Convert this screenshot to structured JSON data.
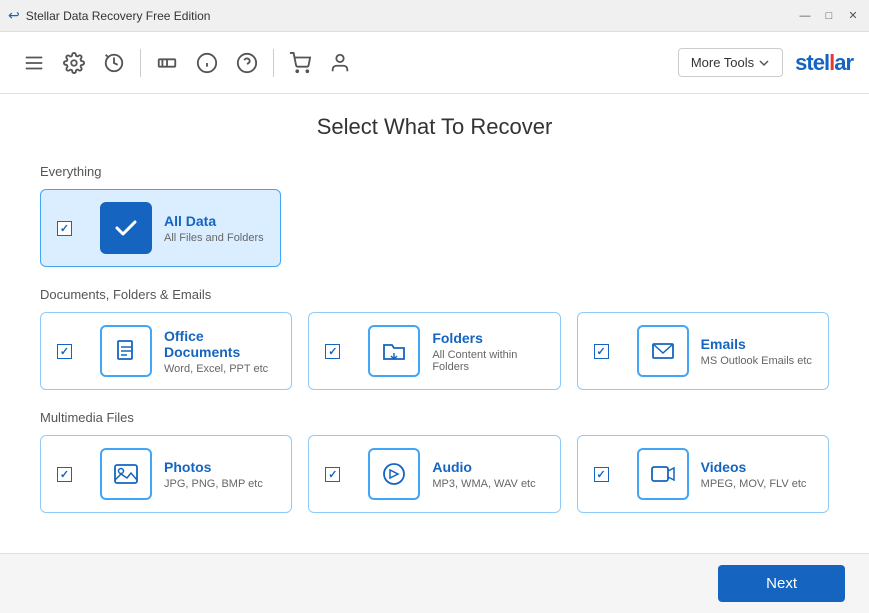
{
  "titleBar": {
    "title": "Stellar Data Recovery Free Edition",
    "minimize": "—",
    "maximize": "□",
    "close": "✕"
  },
  "toolbar": {
    "moreToolsLabel": "More Tools",
    "logoText": "stel",
    "logoAccent": "l",
    "logoRest": "ar"
  },
  "page": {
    "title": "Select What To Recover"
  },
  "sections": [
    {
      "label": "Everything",
      "cards": [
        {
          "id": "all-data",
          "title": "All Data",
          "subtitle": "All Files and Folders",
          "checked": true,
          "selected": true,
          "iconType": "checkmark"
        }
      ]
    },
    {
      "label": "Documents, Folders & Emails",
      "cards": [
        {
          "id": "office-docs",
          "title": "Office Documents",
          "subtitle": "Word, Excel, PPT etc",
          "checked": true,
          "selected": false,
          "iconType": "document"
        },
        {
          "id": "folders",
          "title": "Folders",
          "subtitle": "All Content within Folders",
          "checked": true,
          "selected": false,
          "iconType": "folder"
        },
        {
          "id": "emails",
          "title": "Emails",
          "subtitle": "MS Outlook Emails etc",
          "checked": true,
          "selected": false,
          "iconType": "email"
        }
      ]
    },
    {
      "label": "Multimedia Files",
      "cards": [
        {
          "id": "photos",
          "title": "Photos",
          "subtitle": "JPG, PNG, BMP etc",
          "checked": true,
          "selected": false,
          "iconType": "photo"
        },
        {
          "id": "audio",
          "title": "Audio",
          "subtitle": "MP3, WMA, WAV etc",
          "checked": true,
          "selected": false,
          "iconType": "audio"
        },
        {
          "id": "videos",
          "title": "Videos",
          "subtitle": "MPEG, MOV, FLV etc",
          "checked": true,
          "selected": false,
          "iconType": "video"
        }
      ]
    }
  ],
  "footer": {
    "nextLabel": "Next"
  }
}
